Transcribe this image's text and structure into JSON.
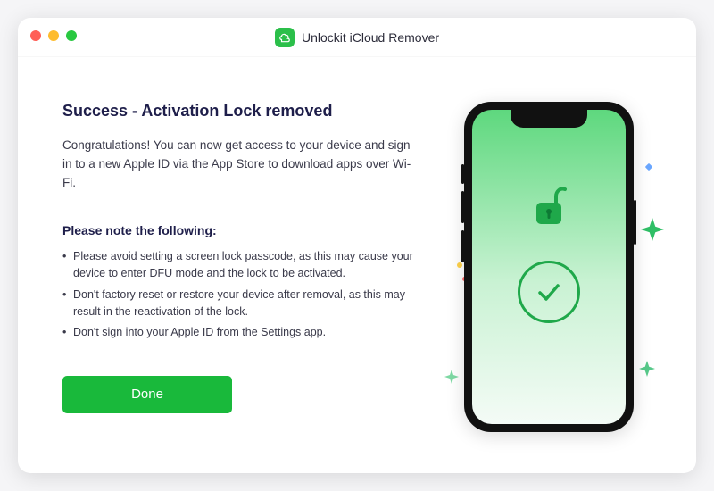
{
  "app": {
    "title": "Unlockit iCloud Remover"
  },
  "main": {
    "heading": "Success - Activation Lock removed",
    "congrats": "Congratulations! You can now get access to your device and sign in to a new Apple ID via the App Store to download apps over Wi-Fi.",
    "note_heading": "Please note the following:",
    "bullets": [
      "Please avoid setting a screen lock passcode, as this may cause your device to enter DFU mode and the lock to be activated.",
      "Don't factory reset or restore your device after removal, as this may result in the reactivation of the lock.",
      "Don't sign into your Apple ID from the Settings app."
    ],
    "done_label": "Done"
  },
  "colors": {
    "primary_green": "#19b93b",
    "heading_navy": "#1e1e4a"
  }
}
